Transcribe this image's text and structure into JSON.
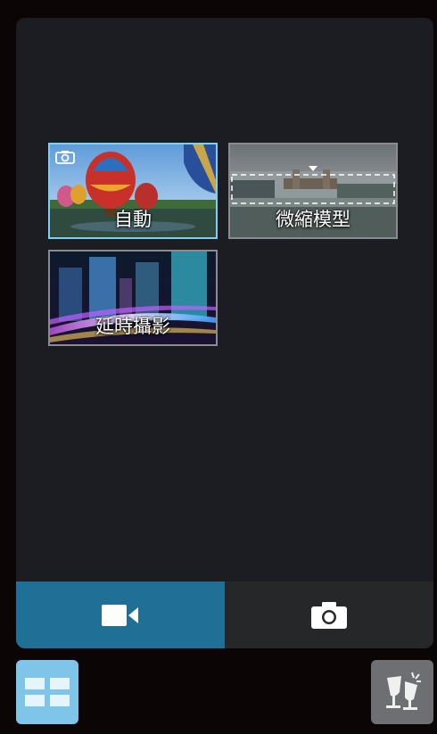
{
  "modes": [
    {
      "label": "自動",
      "selected": true,
      "icon": "camera-badge-icon"
    },
    {
      "label": "微縮模型",
      "selected": false
    },
    {
      "label": "延時攝影",
      "selected": false
    }
  ],
  "bottom_bar": {
    "video_icon": "video-camera-icon",
    "photo_icon": "camera-icon",
    "active": "video"
  },
  "corner_buttons": {
    "left_icon": "grid-icon",
    "right_icon": "effects-icon"
  },
  "colors": {
    "accent": "#1f6f96",
    "selected_border": "#7fcff2",
    "grid_button": "#7fc5ea",
    "panel": "#1c1d22"
  }
}
